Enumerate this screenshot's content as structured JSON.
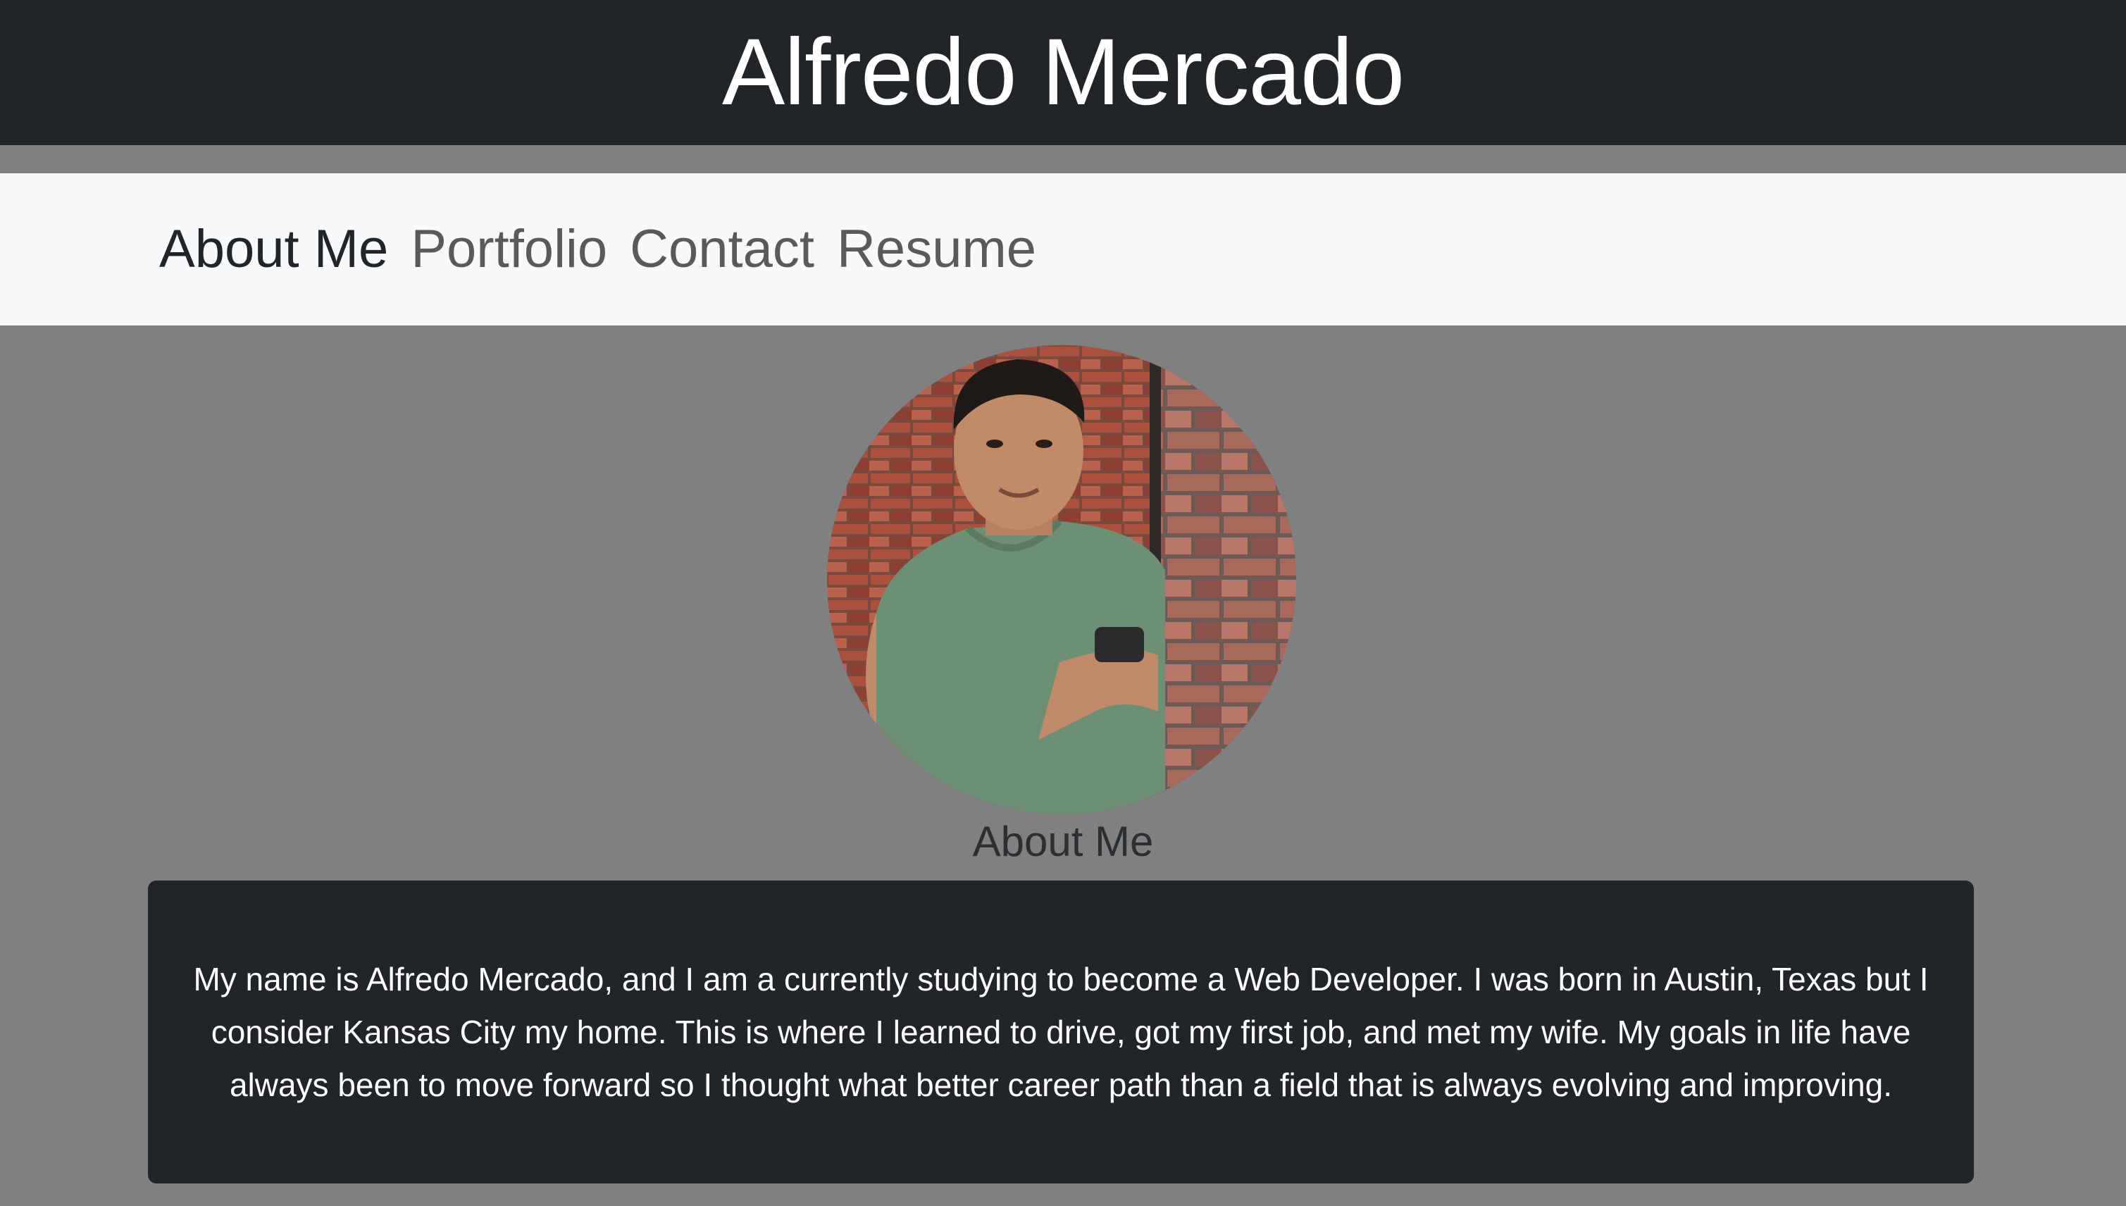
{
  "header": {
    "title": "Alfredo Mercado"
  },
  "nav": {
    "items": [
      {
        "label": "About Me",
        "active": true
      },
      {
        "label": "Portfolio",
        "active": false
      },
      {
        "label": "Contact",
        "active": false
      },
      {
        "label": "Resume",
        "active": false
      }
    ]
  },
  "about": {
    "heading": "About Me",
    "body": "My name is Alfredo Mercado, and I am a currently studying to become a Web Developer. I was born in Austin, Texas but I consider Kansas City my home. This is where I learned to drive, got my first job, and met my wife. My goals in life have always been to move forward so I thought what better career path than a field that is always evolving and improving."
  },
  "colors": {
    "page_background": "#808080",
    "header_background": "#212529",
    "nav_background": "#f8f9fa",
    "card_background": "#212529",
    "nav_active": "#212529",
    "nav_inactive": "#5a5a5a"
  }
}
